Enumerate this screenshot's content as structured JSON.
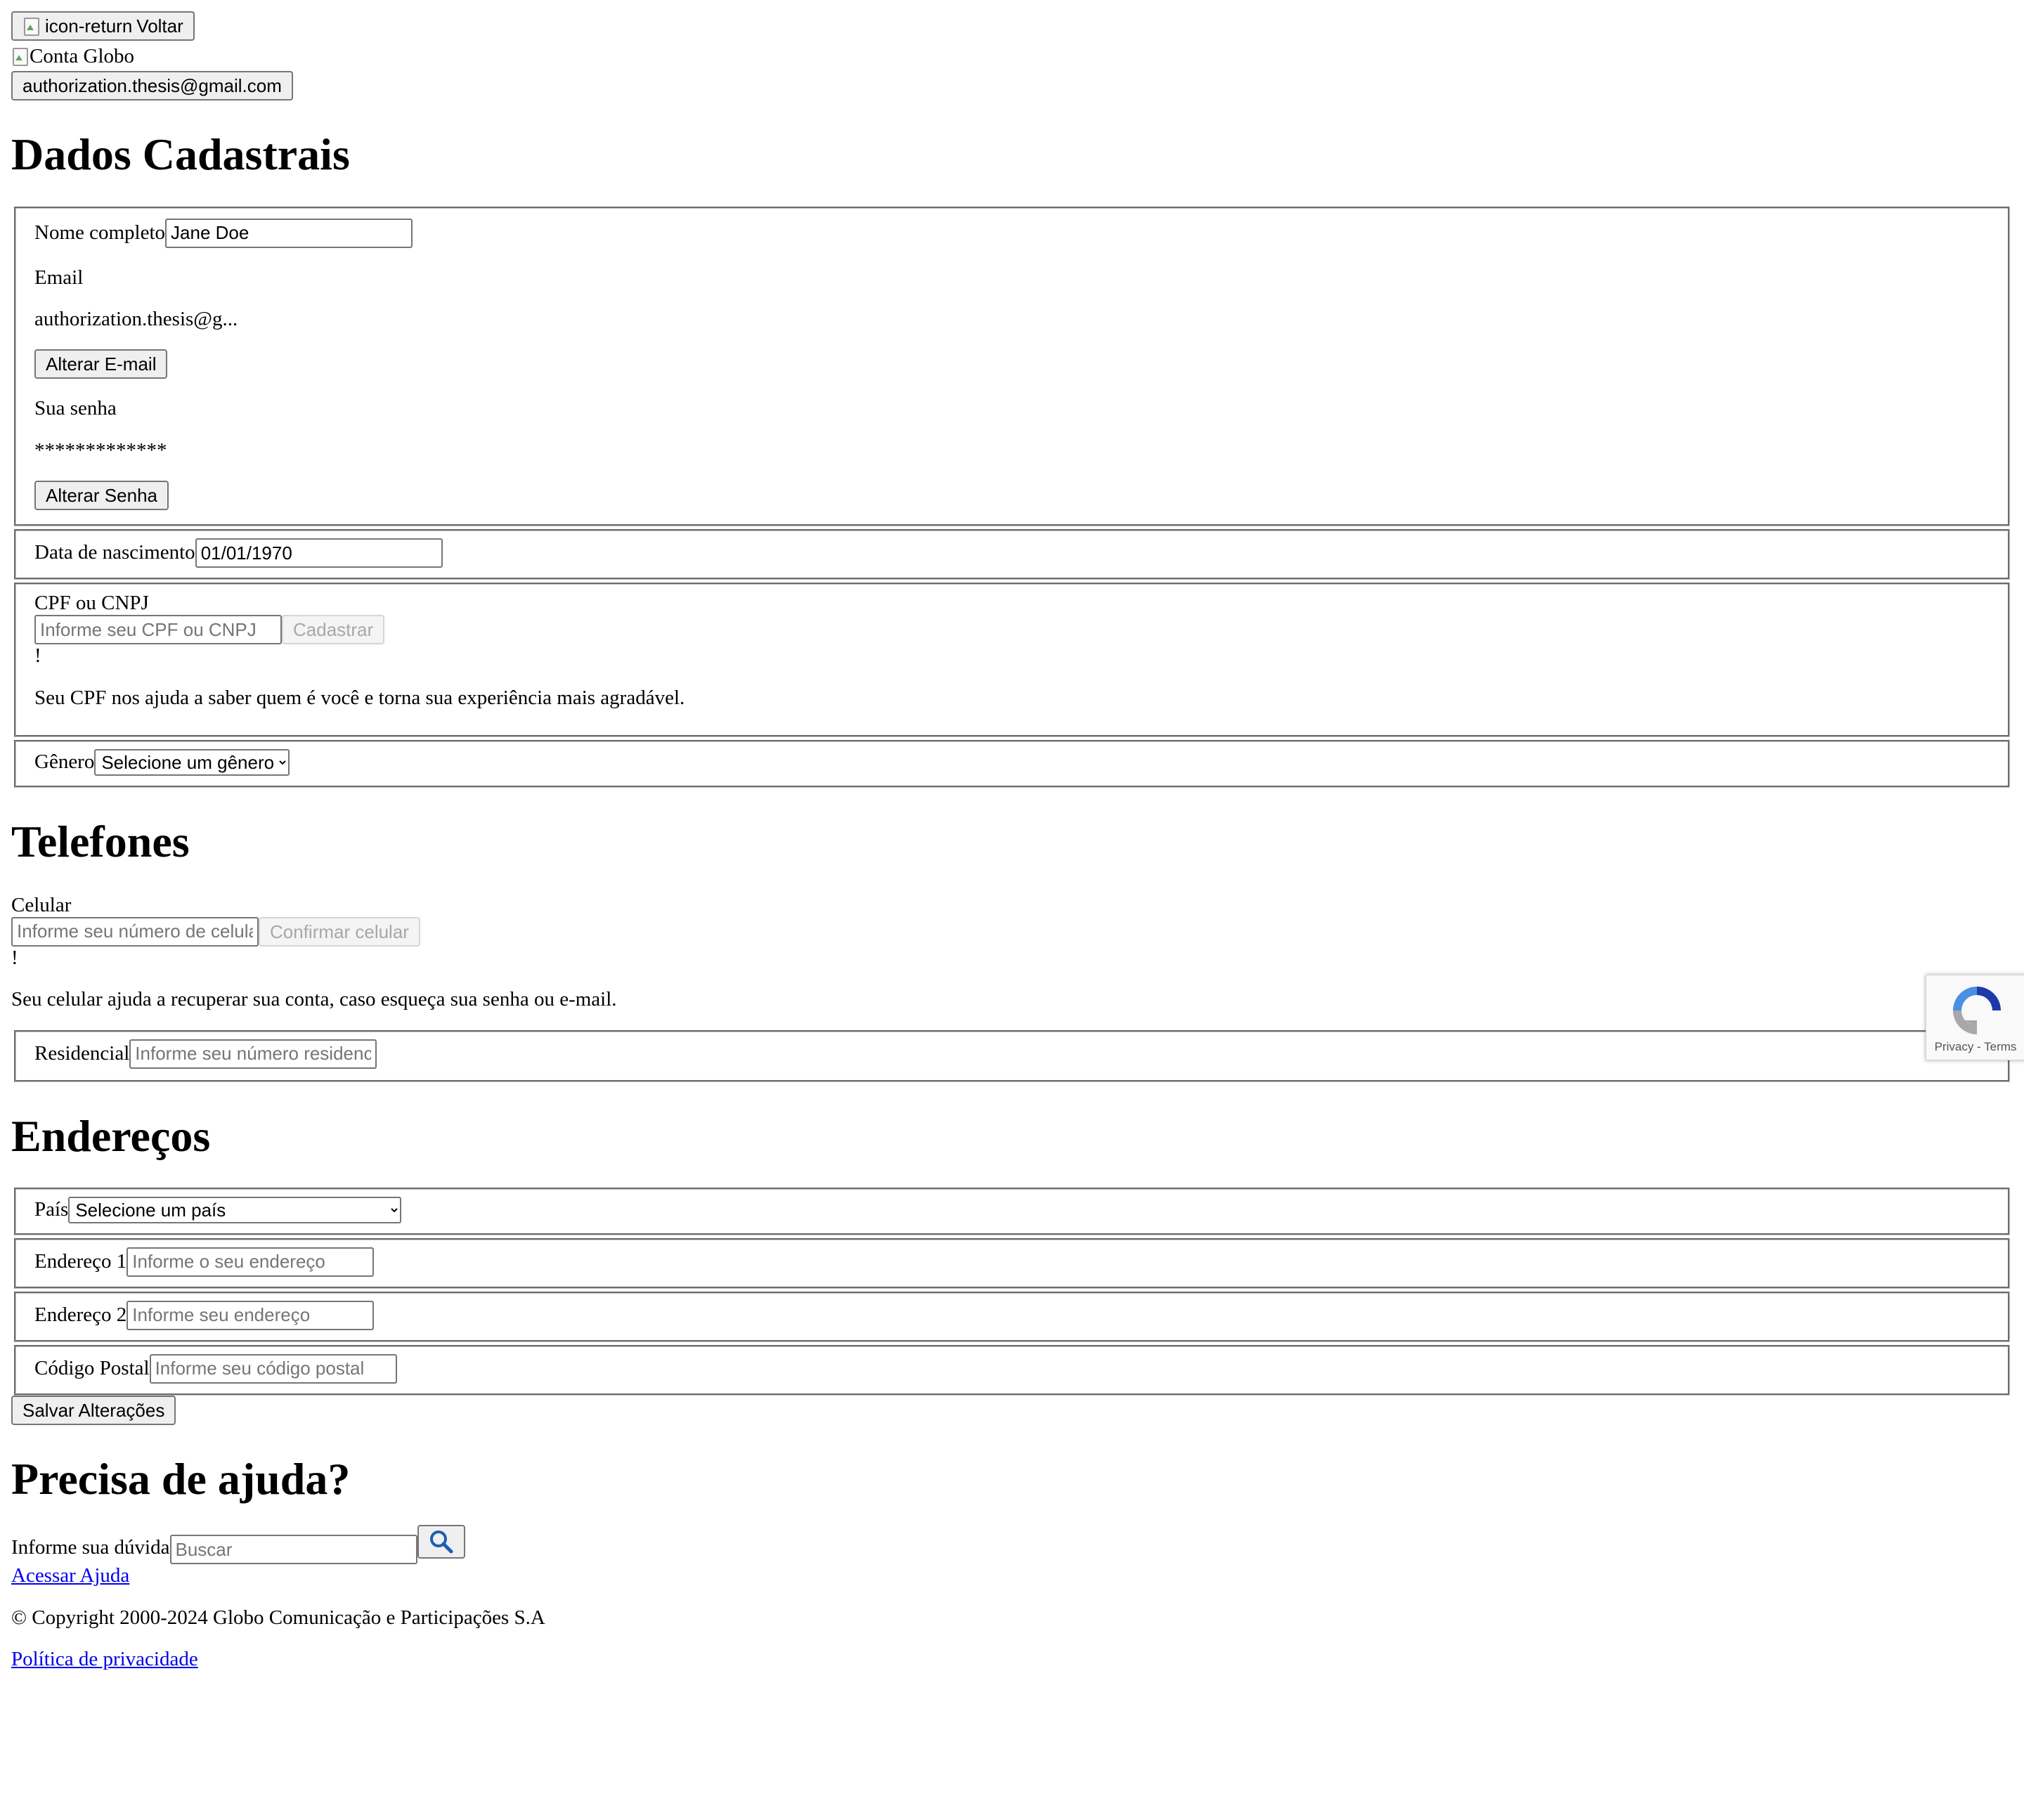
{
  "header": {
    "back_icon_alt": "icon-return",
    "back_label": "Voltar",
    "logo_alt": "Conta Globo",
    "account_email": "authorization.thesis@gmail.com"
  },
  "cadastrais": {
    "title": "Dados Cadastrais",
    "nome_label": "Nome completo",
    "nome_value": "Jane Doe",
    "email_label": "Email",
    "email_value": "authorization.thesis@g...",
    "alterar_email": "Alterar E-mail",
    "senha_label": "Sua senha",
    "senha_value": "*************",
    "alterar_senha": "Alterar Senha",
    "nascimento_label": "Data de nascimento",
    "nascimento_value": "01/01/1970",
    "cpf_label": "CPF ou CNPJ",
    "cpf_placeholder": "Informe seu CPF ou CNPJ",
    "cpf_button": "Cadastrar",
    "cpf_alert": "!",
    "cpf_help": "Seu CPF nos ajuda a saber quem é você e torna sua experiência mais agradável.",
    "genero_label": "Gênero",
    "genero_selected": "Selecione um gênero"
  },
  "telefones": {
    "title": "Telefones",
    "celular_label": "Celular",
    "celular_placeholder": "Informe seu número de celular",
    "celular_button": "Confirmar celular",
    "celular_alert": "!",
    "celular_help": "Seu celular ajuda a recuperar sua conta, caso esqueça sua senha ou e-mail.",
    "residencial_label": "Residencial",
    "residencial_placeholder": "Informe seu número residencial"
  },
  "enderecos": {
    "title": "Endereços",
    "pais_label": "País",
    "pais_selected": "Selecione um país",
    "end1_label": "Endereço 1",
    "end1_placeholder": "Informe o seu endereço",
    "end2_label": "Endereço 2",
    "end2_placeholder": "Informe seu endereço",
    "cep_label": "Código Postal",
    "cep_placeholder": "Informe seu código postal",
    "save_button": "Salvar Alterações"
  },
  "ajuda": {
    "title": "Precisa de ajuda?",
    "duvida_label": "Informe sua dúvida",
    "search_placeholder": "Buscar",
    "search_icon": "search-icon",
    "acessar_link": "Acessar Ajuda"
  },
  "footer": {
    "copyright": "© Copyright 2000-2024 Globo Comunicação e Participações S.A",
    "privacy_link": "Política de privacidade"
  },
  "recaptcha": {
    "terms": "Privacy - Terms"
  },
  "colors": {
    "link": "#0000ee",
    "search_icon": "#1a5fb4",
    "recaptcha_blue": "#1c3aa9",
    "recaptcha_gray": "#a8a8a8"
  }
}
